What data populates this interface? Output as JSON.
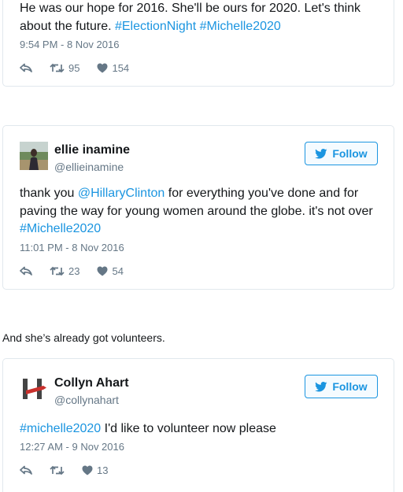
{
  "tweets": [
    {
      "text_parts": [
        {
          "text": "He was our hope for 2016. She'll be ours for 2020. Let's think about the future. "
        },
        {
          "text": "#ElectionNight",
          "link": true
        },
        {
          "text": " "
        },
        {
          "text": "#Michelle2020",
          "link": true
        }
      ],
      "timestamp": "9:54 PM - 8 Nov 2016",
      "retweets": "95",
      "likes": "154"
    },
    {
      "name": "ellie inamine",
      "handle": "@ellieinamine",
      "follow_label": "Follow",
      "text_parts": [
        {
          "text": "thank you "
        },
        {
          "text": "@HillaryClinton",
          "link": true
        },
        {
          "text": " for everything you've done and for paving the way for young women around the globe. it's not over "
        },
        {
          "text": "#Michelle2020",
          "link": true
        }
      ],
      "timestamp": "11:01 PM - 8 Nov 2016",
      "retweets": "23",
      "likes": "54"
    },
    {
      "name": "Collyn Ahart",
      "handle": "@collynahart",
      "follow_label": "Follow",
      "text_parts": [
        {
          "text": "#michelle2020",
          "link": true
        },
        {
          "text": " I'd like to volunteer now please"
        }
      ],
      "timestamp": "12:27 AM - 9 Nov 2016",
      "retweets": "",
      "likes": "13"
    }
  ],
  "caption": "And she’s already got volunteers.",
  "colors": {
    "link": "#1b95e0",
    "meta": "#657786",
    "border": "#e1e8ed"
  },
  "icons": [
    "reply-icon",
    "retweet-icon",
    "heart-icon",
    "twitter-bird-icon"
  ]
}
